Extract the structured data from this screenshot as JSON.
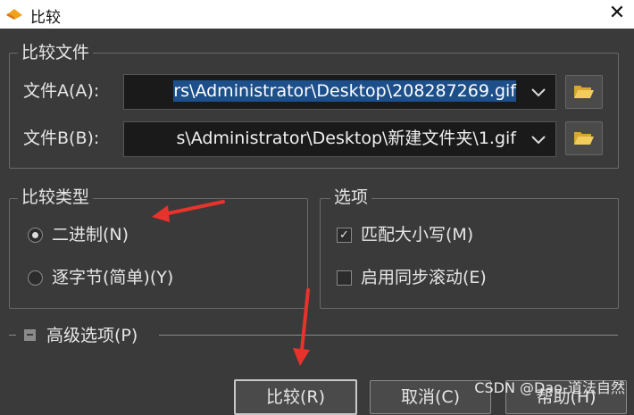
{
  "window": {
    "title": "比较"
  },
  "compare_files": {
    "legend": "比较文件",
    "file_a_label": "文件A(A):",
    "file_a_value": "rs\\Administrator\\Desktop\\208287269.gif",
    "file_b_label": "文件B(B):",
    "file_b_value": "s\\Administrator\\Desktop\\新建文件夹\\1.gif"
  },
  "compare_type": {
    "legend": "比较类型",
    "option_binary": "二进制(N)",
    "option_bytewise": "逐字节(简单)(Y)",
    "selected": "二进制(N)"
  },
  "options": {
    "legend": "选项",
    "match_case": "匹配大小写(M)",
    "match_case_checked": true,
    "sync_scroll": "启用同步滚动(E)",
    "sync_scroll_checked": false
  },
  "advanced": {
    "label": "高级选项(P)"
  },
  "buttons": {
    "compare": "比较(R)",
    "cancel": "取消(C)",
    "help": "帮助(H)"
  },
  "watermark": "CSDN @Dao-道法自然",
  "colors": {
    "annotation_arrow": "#e8332c",
    "selection": "#1d4f8a",
    "folder": "#f0c24a"
  }
}
